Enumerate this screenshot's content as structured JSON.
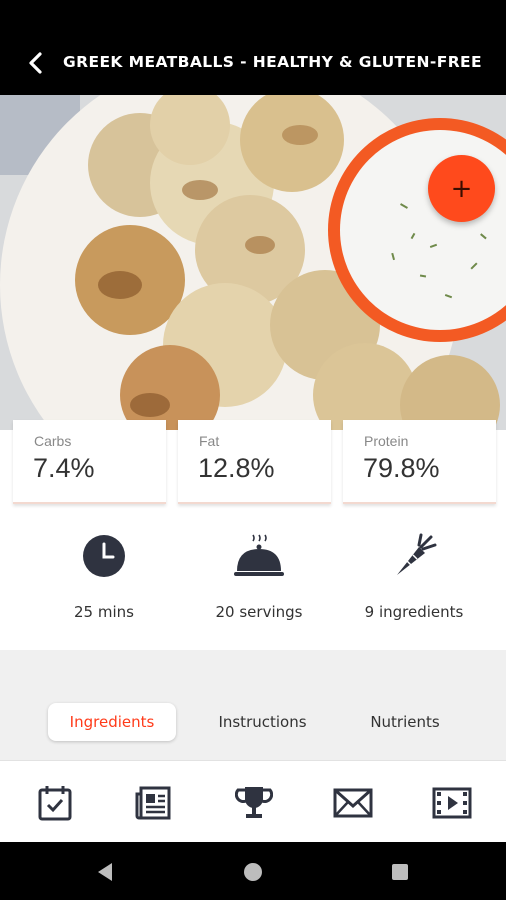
{
  "header": {
    "title": "GREEK MEATBALLS - HEALTHY & GLUTEN-FREE",
    "back_icon": "chevron-left-icon",
    "add_icon": "plus-icon"
  },
  "photo": {
    "description": "meatballs with tzatziki dip"
  },
  "macros": [
    {
      "label": "Carbs",
      "value": "7.4%"
    },
    {
      "label": "Fat",
      "value": "12.8%"
    },
    {
      "label": "Protein",
      "value": "79.8%"
    }
  ],
  "stats": [
    {
      "icon": "clock-icon",
      "text": "25 mins"
    },
    {
      "icon": "serving-cloche-icon",
      "text": "20 servings"
    },
    {
      "icon": "carrot-icon",
      "text": "9 ingredients"
    }
  ],
  "tabs": [
    {
      "label": "Ingredients",
      "active": true
    },
    {
      "label": "Instructions",
      "active": false
    },
    {
      "label": "Nutrients",
      "active": false
    }
  ],
  "bottom_nav": [
    {
      "icon": "calendar-check-icon"
    },
    {
      "icon": "newspaper-icon"
    },
    {
      "icon": "trophy-icon"
    },
    {
      "icon": "mail-icon"
    },
    {
      "icon": "video-icon"
    }
  ],
  "colors": {
    "accent": "#ff4a1c",
    "active_tab_text": "#ff3b1a",
    "icon_dark": "#2f3340"
  }
}
